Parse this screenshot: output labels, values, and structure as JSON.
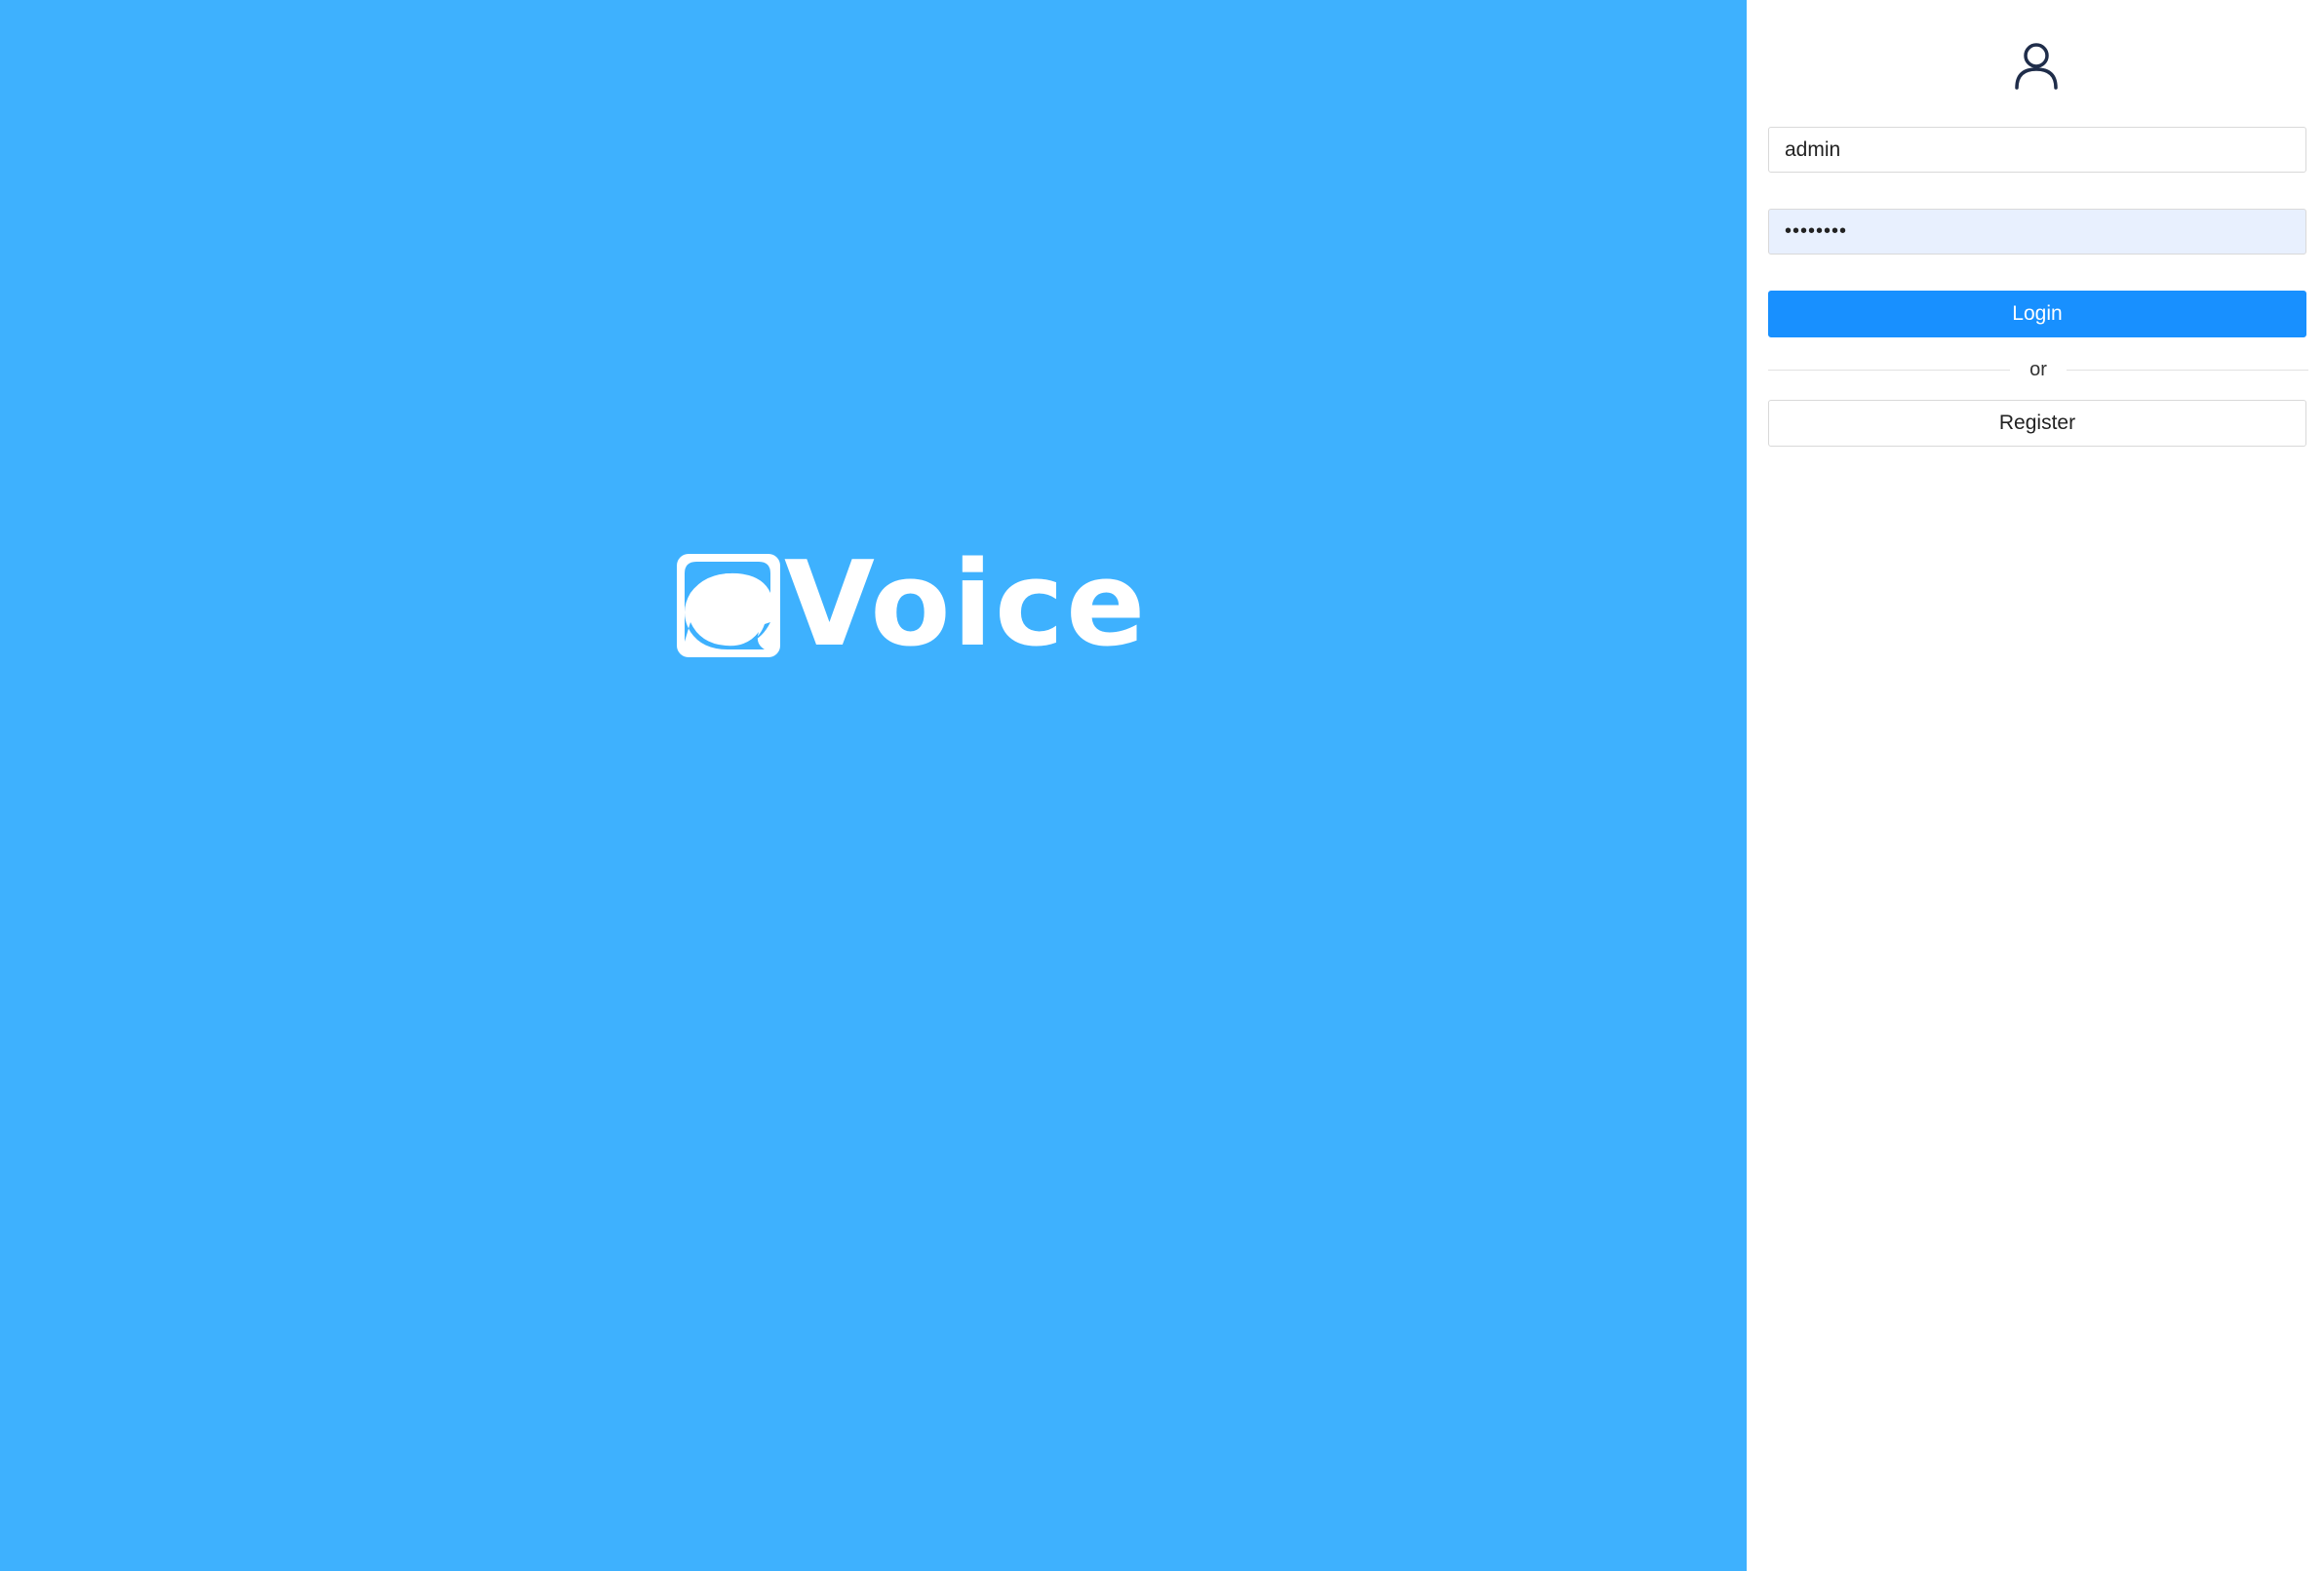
{
  "brand": {
    "name": "Voice",
    "background_color": "#3eb1fe"
  },
  "login_form": {
    "user_icon": "user-icon",
    "username_value": "admin",
    "password_value": "••••••••",
    "login_label": "Login",
    "divider_label": "or",
    "register_label": "Register",
    "accent_color": "#1890ff"
  }
}
